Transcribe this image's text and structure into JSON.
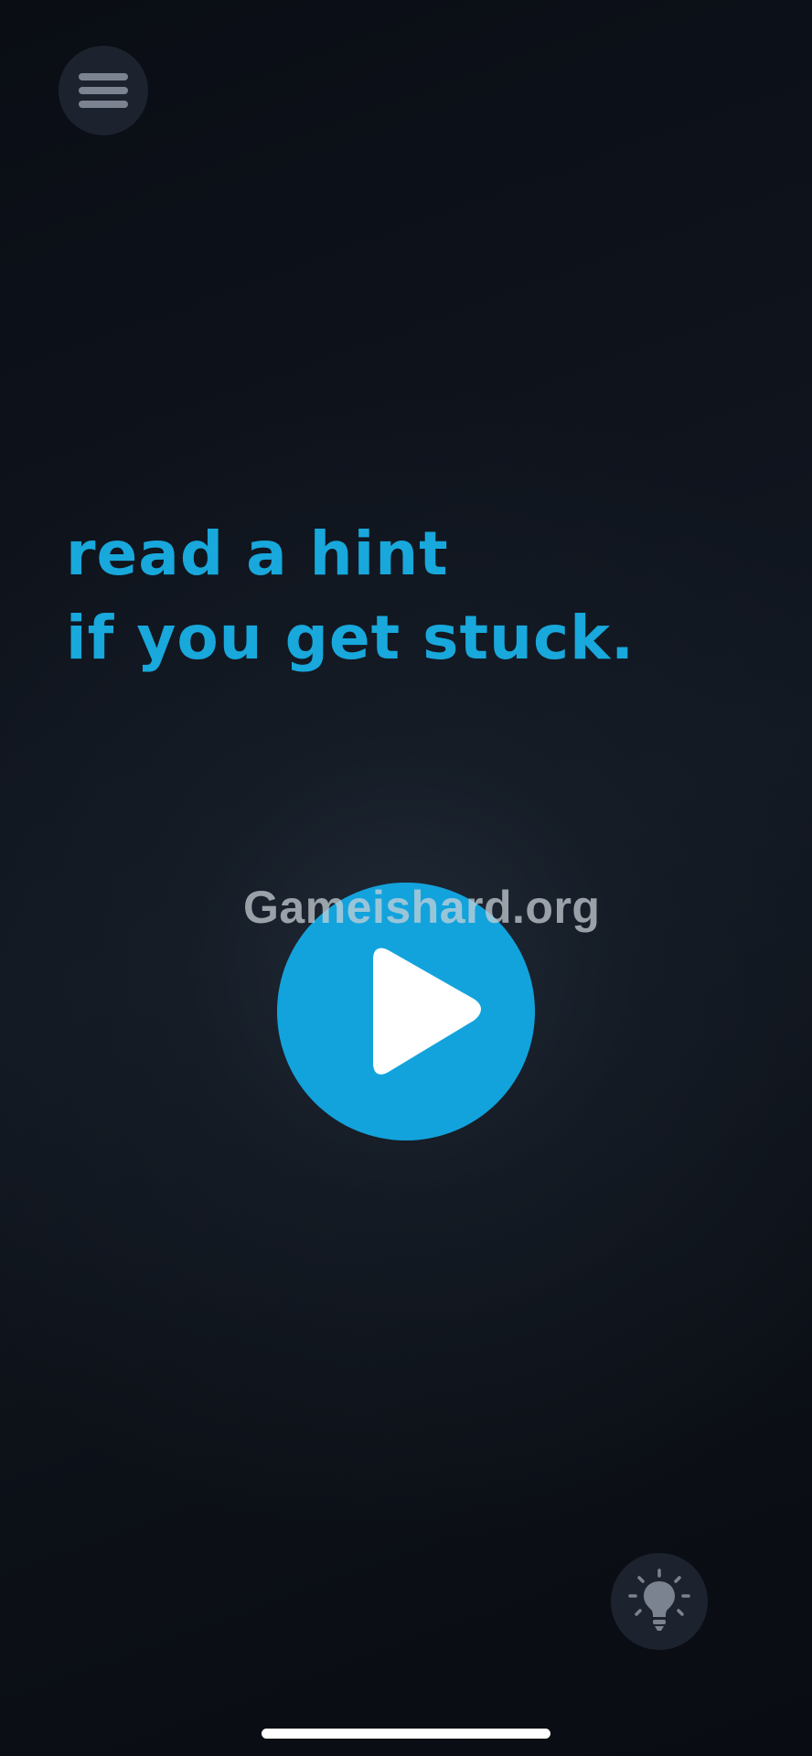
{
  "tutorial": {
    "line1": "read a hint",
    "line2": "if you get stuck."
  },
  "watermark": {
    "text": "Gameishard.org"
  },
  "icons": {
    "menu": "hamburger-menu-icon",
    "play": "play-icon",
    "hint": "lightbulb-icon"
  },
  "colors": {
    "accent": "#18a8dc",
    "background": "#0b0f16",
    "button_bg": "#1c232e",
    "icon_gray": "#7b8391"
  }
}
